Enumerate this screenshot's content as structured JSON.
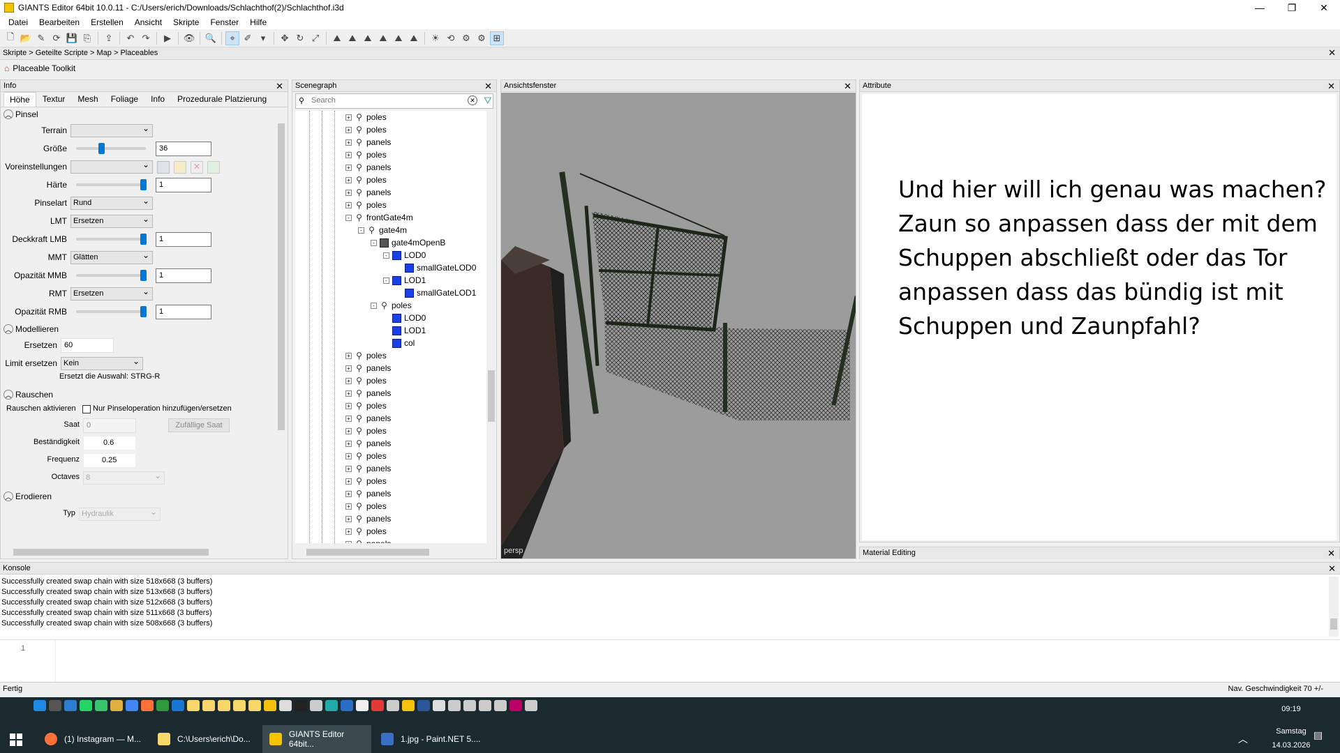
{
  "window": {
    "title": "GIANTS Editor 64bit 10.0.11 - C:/Users/erich/Downloads/Schlachthof(2)/Schlachthof.i3d",
    "min": "—",
    "max": "❐",
    "close": "✕"
  },
  "menu": [
    "Datei",
    "Bearbeiten",
    "Erstellen",
    "Ansicht",
    "Skripte",
    "Fenster",
    "Hilfe"
  ],
  "breadcrumb": "Skripte > Geteilte Scripte > Map > Placeables",
  "toolkit": {
    "title": "Placeable Toolkit"
  },
  "info": {
    "header": "Info",
    "tabs": [
      "Höhe",
      "Textur",
      "Mesh",
      "Foliage",
      "Info",
      "Prozedurale Platzierung"
    ],
    "pinsel": {
      "section": "Pinsel",
      "terrain_label": "Terrain",
      "terrain_value": "",
      "groesse_label": "Größe",
      "groesse_value": "36",
      "groesse_level": 0.35,
      "vorein_label": "Voreinstellungen",
      "vorein_value": "",
      "haerte_label": "Härte",
      "haerte_value": "1",
      "haerte_level": 1.0,
      "pinselart_label": "Pinselart",
      "pinselart_value": "Rund",
      "lmt_label": "LMT",
      "lmt_value": "Ersetzen",
      "deckkraft_label": "Deckkraft LMB",
      "deckkraft_value": "1",
      "deckkraft_level": 1.0,
      "mmt_label": "MMT",
      "mmt_value": "Glätten",
      "opmmb_label": "Opazität MMB",
      "opmmb_value": "1",
      "opmmb_level": 1.0,
      "rmt_label": "RMT",
      "rmt_value": "Ersetzen",
      "oprmb_label": "Opazität RMB",
      "oprmb_value": "1",
      "oprmb_level": 1.0
    },
    "modellieren": {
      "section": "Modellieren",
      "ersetzen_label": "Ersetzen",
      "ersetzen_value": "60",
      "limit_label": "Limit ersetzen",
      "limit_value": "Kein",
      "hint": "Ersetzt die Auswahl: STRG-R"
    },
    "rauschen": {
      "section": "Rauschen",
      "aktivieren_label": "Rauschen aktivieren",
      "checkbox_label": "Nur Pinseloperation hinzufügen/ersetzen",
      "saat_label": "Saat",
      "saat_value": "0",
      "random_button": "Zufällige Saat",
      "best_label": "Beständigkeit",
      "best_value": "0.6",
      "freq_label": "Frequenz",
      "freq_value": "0.25",
      "oct_label": "Octaves",
      "oct_value": "8"
    },
    "erodieren": {
      "section": "Erodieren",
      "typ_label": "Typ",
      "typ_value": "Hydraulik"
    }
  },
  "scenegraph": {
    "header": "Scenegraph",
    "search_placeholder": "Search",
    "items": [
      {
        "label": "poles",
        "depth": 0,
        "icon": "tg",
        "exp": "+"
      },
      {
        "label": "poles",
        "depth": 0,
        "icon": "tg",
        "exp": "+"
      },
      {
        "label": "panels",
        "depth": 0,
        "icon": "tg",
        "exp": "+"
      },
      {
        "label": "poles",
        "depth": 0,
        "icon": "tg",
        "exp": "+"
      },
      {
        "label": "panels",
        "depth": 0,
        "icon": "tg",
        "exp": "+"
      },
      {
        "label": "poles",
        "depth": 0,
        "icon": "tg",
        "exp": "+"
      },
      {
        "label": "panels",
        "depth": 0,
        "icon": "tg",
        "exp": "+"
      },
      {
        "label": "poles",
        "depth": 0,
        "icon": "tg",
        "exp": "+"
      },
      {
        "label": "frontGate4m",
        "depth": 0,
        "icon": "tg",
        "exp": "-"
      },
      {
        "label": "gate4m",
        "depth": 1,
        "icon": "tg",
        "exp": "-"
      },
      {
        "label": "gate4mOpenB",
        "depth": 2,
        "icon": "grp",
        "exp": "-"
      },
      {
        "label": "LOD0",
        "depth": 3,
        "icon": "cube",
        "exp": "-"
      },
      {
        "label": "smallGateLOD0",
        "depth": 4,
        "icon": "cube",
        "exp": ""
      },
      {
        "label": "LOD1",
        "depth": 3,
        "icon": "cube",
        "exp": "-"
      },
      {
        "label": "smallGateLOD1",
        "depth": 4,
        "icon": "cube",
        "exp": ""
      },
      {
        "label": "poles",
        "depth": 2,
        "icon": "tg",
        "exp": "-"
      },
      {
        "label": "LOD0",
        "depth": 3,
        "icon": "cube",
        "exp": ""
      },
      {
        "label": "LOD1",
        "depth": 3,
        "icon": "cube",
        "exp": ""
      },
      {
        "label": "col",
        "depth": 3,
        "icon": "cube",
        "exp": ""
      },
      {
        "label": "poles",
        "depth": 0,
        "icon": "tg",
        "exp": "+"
      },
      {
        "label": "panels",
        "depth": 0,
        "icon": "tg",
        "exp": "+"
      },
      {
        "label": "poles",
        "depth": 0,
        "icon": "tg",
        "exp": "+"
      },
      {
        "label": "panels",
        "depth": 0,
        "icon": "tg",
        "exp": "+"
      },
      {
        "label": "poles",
        "depth": 0,
        "icon": "tg",
        "exp": "+"
      },
      {
        "label": "panels",
        "depth": 0,
        "icon": "tg",
        "exp": "+"
      },
      {
        "label": "poles",
        "depth": 0,
        "icon": "tg",
        "exp": "+"
      },
      {
        "label": "panels",
        "depth": 0,
        "icon": "tg",
        "exp": "+"
      },
      {
        "label": "poles",
        "depth": 0,
        "icon": "tg",
        "exp": "+"
      },
      {
        "label": "panels",
        "depth": 0,
        "icon": "tg",
        "exp": "+"
      },
      {
        "label": "poles",
        "depth": 0,
        "icon": "tg",
        "exp": "+"
      },
      {
        "label": "panels",
        "depth": 0,
        "icon": "tg",
        "exp": "+"
      },
      {
        "label": "poles",
        "depth": 0,
        "icon": "tg",
        "exp": "+"
      },
      {
        "label": "panels",
        "depth": 0,
        "icon": "tg",
        "exp": "+"
      },
      {
        "label": "poles",
        "depth": 0,
        "icon": "tg",
        "exp": "+"
      },
      {
        "label": "panels",
        "depth": 0,
        "icon": "tg",
        "exp": "+"
      }
    ]
  },
  "viewport": {
    "header": "Ansichtsfenster",
    "camera": "persp"
  },
  "attribute": {
    "header": "Attribute",
    "overlay_text": "Und hier will ich genau was machen? Zaun so anpassen dass der mit dem Schuppen abschließt oder das Tor anpassen dass das bündig ist mit Schuppen und Zaunpfahl?"
  },
  "material": {
    "header": "Material Editing"
  },
  "console": {
    "header": "Konsole",
    "lines": [
      "Successfully created swap chain with size 518x668 (3 buffers)",
      "Successfully created swap chain with size 513x668 (3 buffers)",
      "Successfully created swap chain with size 512x668 (3 buffers)",
      "Successfully created swap chain with size 511x668 (3 buffers)",
      "Successfully created swap chain with size 508x668 (3 buffers)"
    ],
    "line_number": "1"
  },
  "status": {
    "left": "Fertig",
    "right": "Nav. Geschwindigkeit 70 +/-"
  },
  "taskbar": {
    "tasks": [
      "(1) Instagram — M...",
      "C:\\Users\\erich\\Do...",
      "GIANTS Editor 64bit...",
      "1.jpg - Paint.NET 5...."
    ],
    "time": "09:19",
    "day": "Samstag",
    "date": "14.03.2026"
  },
  "colors": {
    "accent": "#0078d7",
    "cube": "#1a3ee8",
    "taskbar": "#1b2a2e"
  }
}
